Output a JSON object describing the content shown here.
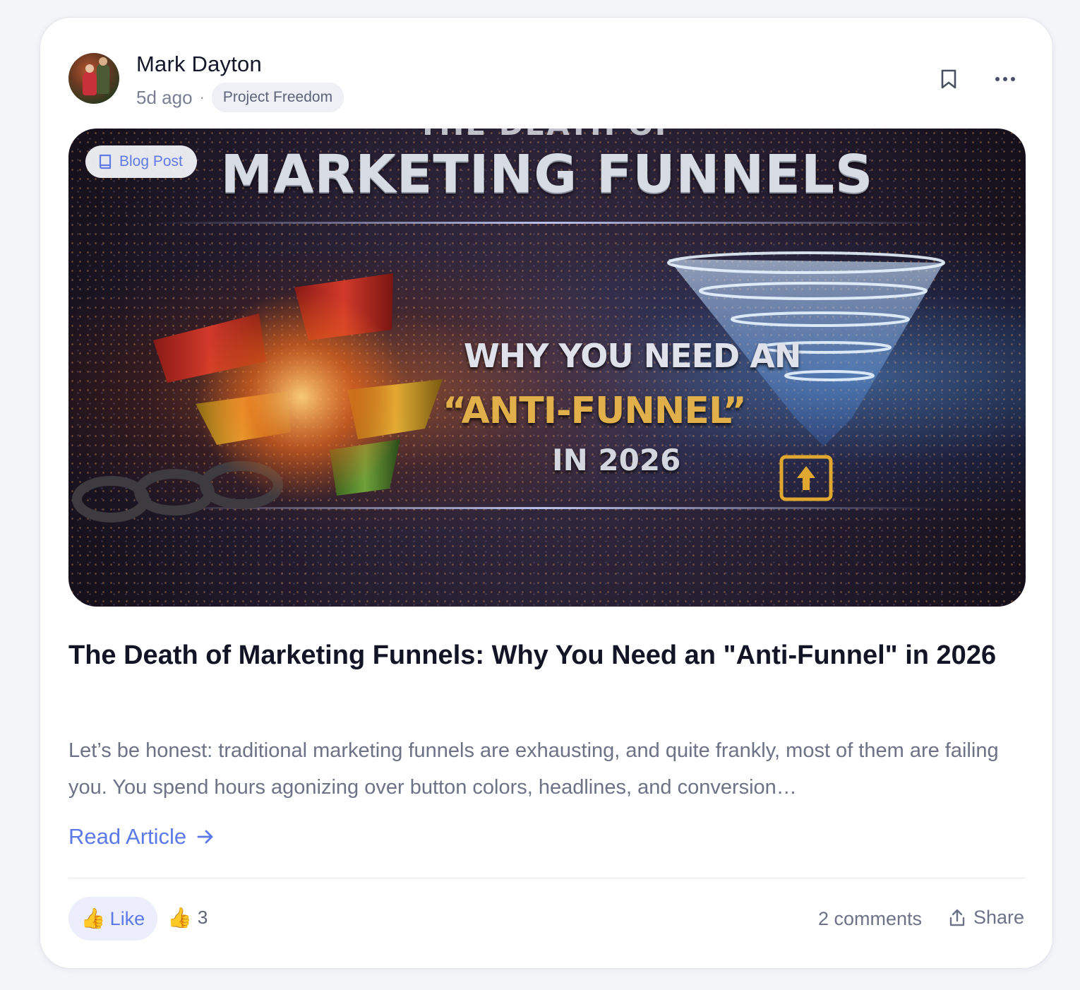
{
  "post": {
    "author": "Mark Dayton",
    "time_ago": "5d ago",
    "separator": "·",
    "community": "Project Freedom"
  },
  "hero": {
    "badge_label": "Blog Post",
    "top_text": "THE DEATH OF",
    "title": "MARKETING FUNNELS",
    "line1": "WHY YOU NEED AN",
    "line2": "“ANTI-FUNNEL”",
    "line3": "IN 2026"
  },
  "article": {
    "title": "The Death of Marketing Funnels: Why You Need an \"Anti-Funnel\" in 2026",
    "excerpt": "Let’s be honest: traditional marketing funnels are exhausting, and quite frankly, most of them are failing you. You spend hours agonizing over button colors, headlines, and conversion…",
    "read_more": "Read Article"
  },
  "footer": {
    "like_label": "Like",
    "reaction_count": "3",
    "comments": "2 comments",
    "share_label": "Share"
  },
  "icons": {
    "bookmark": "bookmark-icon",
    "more": "more-horizontal-icon",
    "badge": "book-icon",
    "arrow": "arrow-right-icon",
    "like": "thumbs-up-emoji",
    "share": "share-icon"
  },
  "colors": {
    "accent": "#5b7ae8",
    "text_primary": "#131527",
    "text_muted": "#6d7287",
    "like_bg": "#eceefb",
    "tag_bg": "#eef0f6"
  }
}
